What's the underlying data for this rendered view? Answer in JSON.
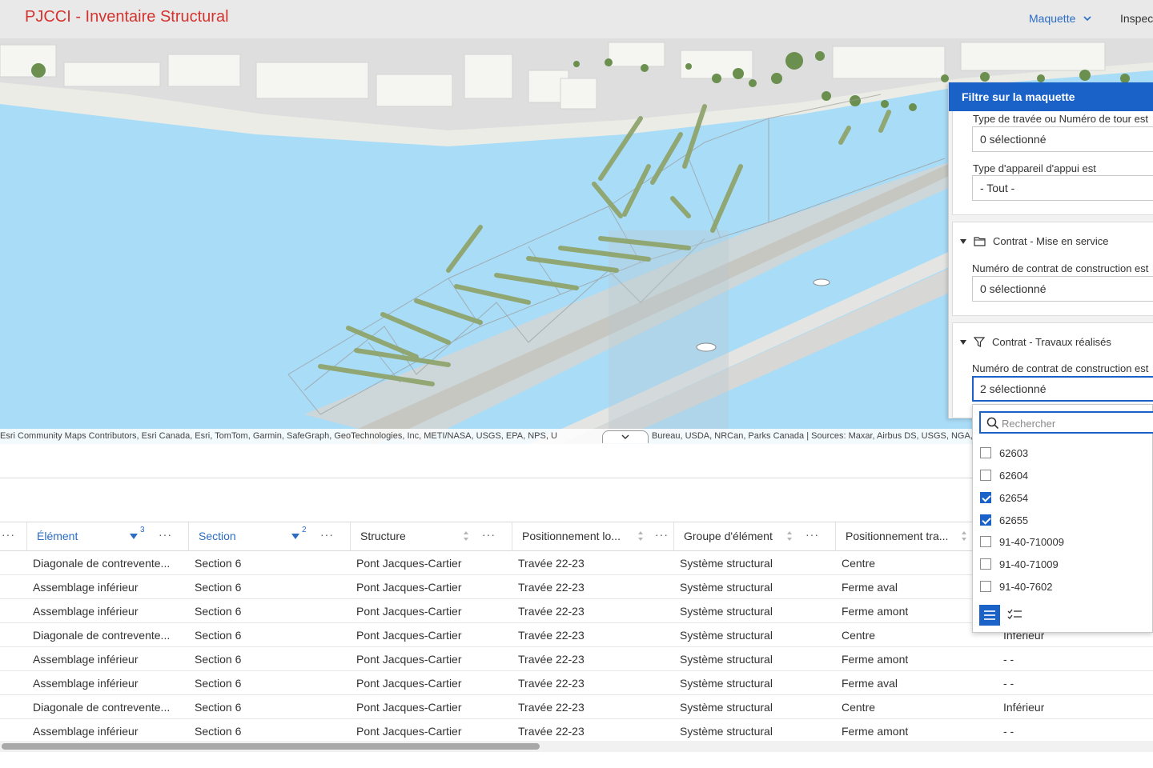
{
  "header": {
    "title": "PJCCI - Inventaire Structural",
    "nav_maquette": "Maquette",
    "nav_inspection": "Inspec"
  },
  "scene": {
    "attribution_left": "Esri Community Maps Contributors, Esri Canada, Esri, TomTom, Garmin, SafeGraph, GeoTechnologies, Inc, METI/NASA, USGS, EPA, NPS, U",
    "attribution_right": "Bureau, USDA, NRCan, Parks Canada | Sources: Maxar, Airbus DS, USGS, NGA, NASA, CGIAR"
  },
  "filter_panel": {
    "title": "Filtre sur la maquette",
    "travee_label": "Type de travée ou Numéro de tour est",
    "travee_value": "0 sélectionné",
    "appareil_label": "Type d'appareil d'appui est",
    "appareil_value": "- Tout -",
    "section_mise_en_service": "Contrat - Mise en service",
    "contrat_mes_label": "Numéro de contrat de construction est",
    "contrat_mes_value": "0 sélectionné",
    "section_travaux": "Contrat - Travaux réalisés",
    "contrat_tr_label": "Numéro de contrat de construction est",
    "contrat_tr_value": "2 sélectionné"
  },
  "dropdown": {
    "search_placeholder": "Rechercher",
    "options": [
      {
        "label": "62603",
        "checked": false
      },
      {
        "label": "62604",
        "checked": false
      },
      {
        "label": "62654",
        "checked": true
      },
      {
        "label": "62655",
        "checked": true
      },
      {
        "label": "91-40-710009",
        "checked": false
      },
      {
        "label": "91-40-71009",
        "checked": false
      },
      {
        "label": "91-40-7602",
        "checked": false
      }
    ]
  },
  "table": {
    "columns": [
      {
        "label": "Élément",
        "sort_order": "3"
      },
      {
        "label": "Section",
        "sort_order": "2"
      },
      {
        "label": "Structure",
        "sort_order": ""
      },
      {
        "label": "Positionnement lo...",
        "sort_order": ""
      },
      {
        "label": "Groupe d'élément",
        "sort_order": ""
      },
      {
        "label": "Positionnement tra...",
        "sort_order": ""
      }
    ],
    "rows": [
      [
        "Diagonale de contrevente...",
        "Section 6",
        "Pont Jacques-Cartier",
        "Travée 22-23",
        "Système structural",
        "Centre",
        ""
      ],
      [
        "Assemblage inférieur",
        "Section 6",
        "Pont Jacques-Cartier",
        "Travée 22-23",
        "Système structural",
        "Ferme aval",
        ""
      ],
      [
        "Assemblage inférieur",
        "Section 6",
        "Pont Jacques-Cartier",
        "Travée 22-23",
        "Système structural",
        "Ferme amont",
        ""
      ],
      [
        "Diagonale de contrevente...",
        "Section 6",
        "Pont Jacques-Cartier",
        "Travée 22-23",
        "Système structural",
        "Centre",
        "Inférieur"
      ],
      [
        "Assemblage inférieur",
        "Section 6",
        "Pont Jacques-Cartier",
        "Travée 22-23",
        "Système structural",
        "Ferme amont",
        "- -"
      ],
      [
        "Assemblage inférieur",
        "Section 6",
        "Pont Jacques-Cartier",
        "Travée 22-23",
        "Système structural",
        "Ferme aval",
        "- -"
      ],
      [
        "Diagonale de contrevente...",
        "Section 6",
        "Pont Jacques-Cartier",
        "Travée 22-23",
        "Système structural",
        "Centre",
        "Inférieur"
      ],
      [
        "Assemblage inférieur",
        "Section 6",
        "Pont Jacques-Cartier",
        "Travée 22-23",
        "Système structural",
        "Ferme amont",
        "- -"
      ]
    ]
  },
  "colors": {
    "brand_red": "#d3342f",
    "accent_blue": "#1a62c8",
    "water": "#a9dcf7"
  }
}
